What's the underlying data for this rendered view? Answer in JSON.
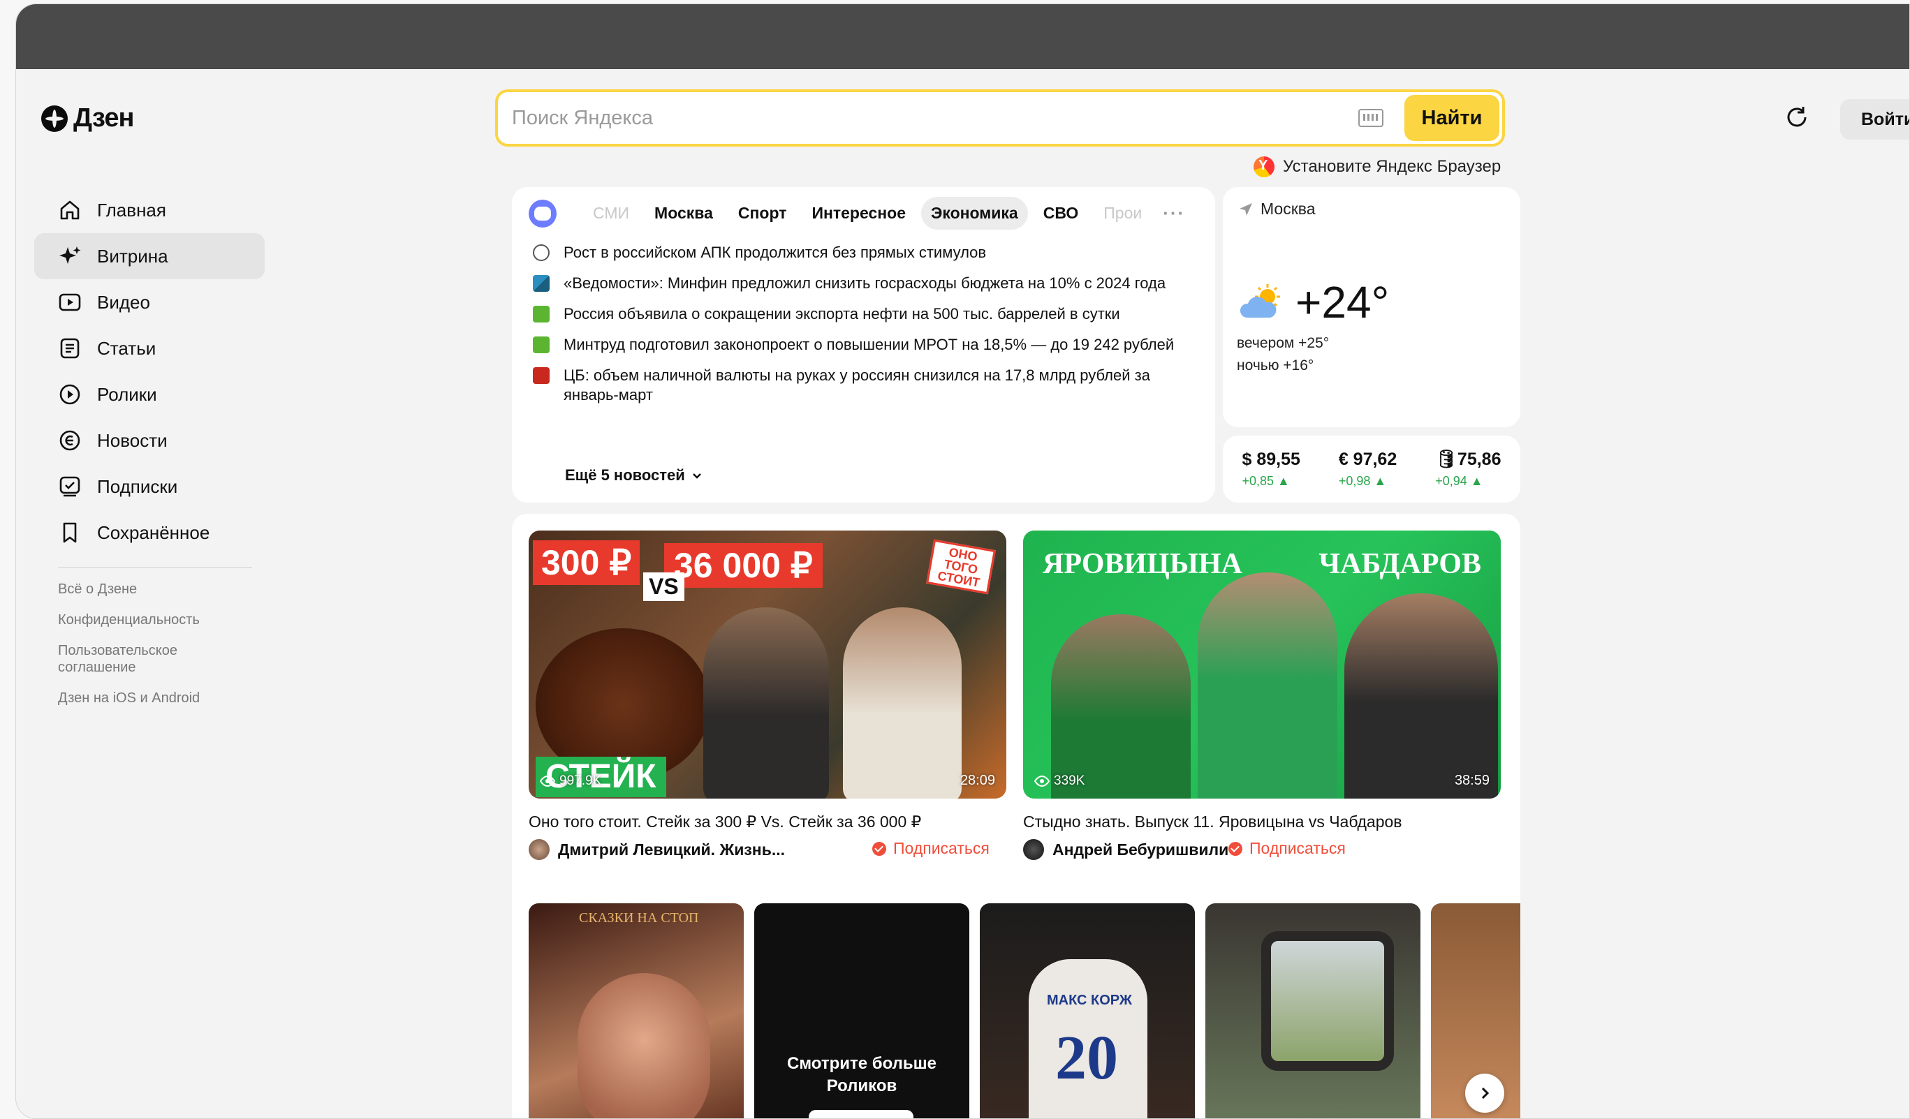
{
  "app": {
    "logo_text": "Дзен"
  },
  "search": {
    "placeholder": "Поиск Яндекса",
    "value": "",
    "button_label": "Найти"
  },
  "header": {
    "login_label": "Войти",
    "promo_text": "Установите Яндекс Браузер"
  },
  "sidebar": {
    "items": [
      {
        "label": "Главная",
        "icon": "home-icon",
        "active": false
      },
      {
        "label": "Витрина",
        "icon": "sparkle-icon",
        "active": true
      },
      {
        "label": "Видео",
        "icon": "video-icon",
        "active": false
      },
      {
        "label": "Статьи",
        "icon": "article-icon",
        "active": false
      },
      {
        "label": "Ролики",
        "icon": "shorts-icon",
        "active": false
      },
      {
        "label": "Новости",
        "icon": "news-icon",
        "active": false
      },
      {
        "label": "Подписки",
        "icon": "subscriptions-icon",
        "active": false
      },
      {
        "label": "Сохранённое",
        "icon": "bookmark-icon",
        "active": false
      }
    ],
    "links": [
      "Всё о Дзене",
      "Конфиденциальность",
      "Пользовательское соглашение",
      "Дзен на iOS и Android"
    ]
  },
  "news": {
    "tabs": [
      "СМИ",
      "Москва",
      "Спорт",
      "Интересное",
      "Экономика",
      "СВО",
      "Прои"
    ],
    "active_tab": "Экономика",
    "items": [
      {
        "text": "Рост в российском АПК продолжится без прямых стимулов",
        "icon_color": "#ffffff"
      },
      {
        "text": "«Ведомости»: Минфин предложил снизить госрасходы бюджета на 10% с 2024 года",
        "icon_color": "#2a8fc0"
      },
      {
        "text": "Россия объявила о сокращении экспорта нефти на 500 тыс. баррелей в сутки",
        "icon_color": "#5cb531"
      },
      {
        "text": "Минтруд подготовил законопроект о повышении МРОТ на 18,5% — до 19 242 рублей",
        "icon_color": "#5cb531"
      },
      {
        "text": "ЦБ: объем наличной валюты на руках у россиян снизился на 17,8 млрд рублей за январь-март",
        "icon_color": "#c8281e"
      }
    ],
    "more_label": "Ещё 5 новостей"
  },
  "weather": {
    "city": "Москва",
    "temp": "+24°",
    "evening": "вечером +25°",
    "night": "ночью +16°"
  },
  "currency": [
    {
      "value": "$ 89,55",
      "delta": "+0,85 ▲"
    },
    {
      "value": "€ 97,62",
      "delta": "+0,98 ▲"
    },
    {
      "value": "🛢75,86",
      "delta": "+0,94 ▲"
    }
  ],
  "videos": [
    {
      "title": "Оно того стоит. Стейк за 300 ₽ Vs. Стейк за 36 000 ₽",
      "author": "Дмитрий Левицкий. Жизнь...",
      "views": "997.9K",
      "duration": "28:09",
      "subscribe_label": "Подписаться",
      "thumb_texts": {
        "price_low": "300 ₽",
        "price_high": "36 000 ₽",
        "vs": "VS",
        "tag": "ОНО ТОГО СТОИТ",
        "word": "СТЕЙК"
      }
    },
    {
      "title": "Стыдно знать. Выпуск 11. Яровицына vs Чабдаров",
      "author": "Андрей Бебуришвили",
      "views": "339K",
      "duration": "38:59",
      "subscribe_label": "Подписаться",
      "thumb_texts": {
        "left_name": "ЯРОВИЦЫНА",
        "right_name": "ЧАБДАРОВ"
      }
    }
  ],
  "shorts": {
    "first_caption": "СКАЗКИ НА СТОП",
    "promo_text": "Смотрите больше Роликов",
    "jersey_name": "МАКС КОРЖ",
    "jersey_number": "20"
  },
  "colors": {
    "accent_yellow": "#fbd542",
    "subscribe_red": "#f04d3a",
    "positive_green": "#2aa54a"
  }
}
